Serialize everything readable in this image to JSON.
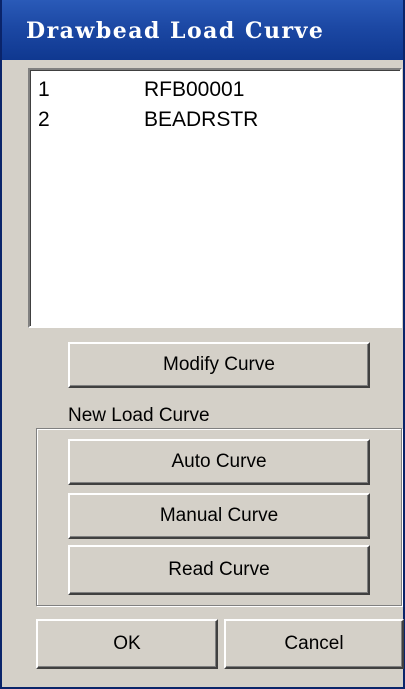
{
  "window": {
    "title": "Drawbead Load Curve"
  },
  "curve_list": {
    "items": [
      {
        "number": "1",
        "name": "RFB00001"
      },
      {
        "number": "2",
        "name": "BEADRSTR"
      }
    ]
  },
  "buttons": {
    "modify": "Modify Curve",
    "auto": "Auto Curve",
    "manual": "Manual Curve",
    "read": "Read Curve",
    "ok": "OK",
    "cancel": "Cancel"
  },
  "new_load_curve_group": {
    "label": "New Load Curve"
  }
}
